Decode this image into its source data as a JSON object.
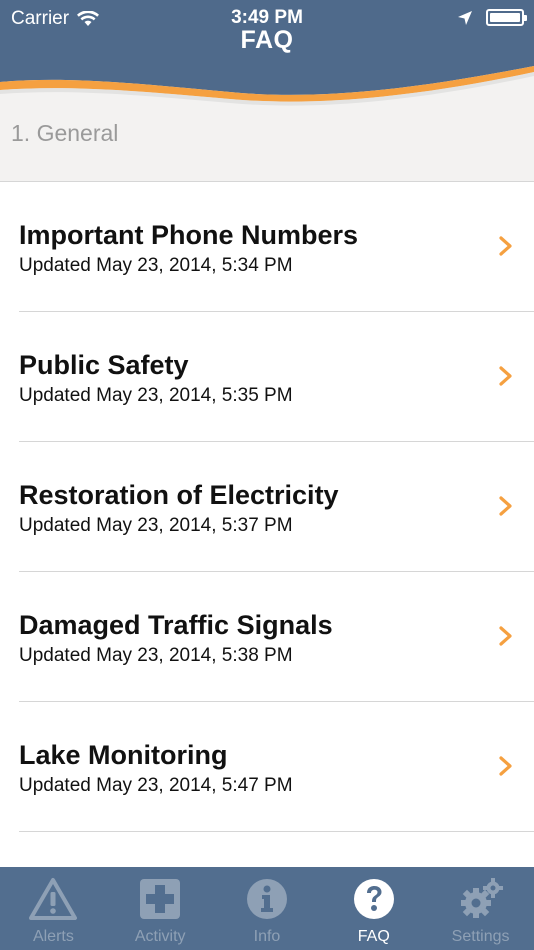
{
  "status_bar": {
    "carrier": "Carrier",
    "time": "3:49 PM",
    "battery_level": 1.0
  },
  "header": {
    "title": "FAQ",
    "section": "1. General"
  },
  "faq_items": [
    {
      "title": "Important Phone Numbers",
      "updated": "Updated May 23, 2014, 5:34 PM"
    },
    {
      "title": "Public Safety",
      "updated": "Updated May 23, 2014, 5:35 PM"
    },
    {
      "title": "Restoration of Electricity",
      "updated": "Updated May 23, 2014, 5:37 PM"
    },
    {
      "title": "Damaged Traffic Signals",
      "updated": "Updated May 23, 2014, 5:38 PM"
    },
    {
      "title": "Lake Monitoring",
      "updated": "Updated May 23, 2014, 5:47 PM"
    }
  ],
  "tab_bar": {
    "tabs": [
      {
        "label": "Alerts",
        "icon": "warning-triangle-icon"
      },
      {
        "label": "Activity",
        "icon": "medical-cross-icon"
      },
      {
        "label": "Info",
        "icon": "info-circle-icon"
      },
      {
        "label": "FAQ",
        "icon": "question-circle-icon"
      },
      {
        "label": "Settings",
        "icon": "gears-icon"
      }
    ],
    "active_tab": "FAQ"
  },
  "colors": {
    "header_blue": "#4f6a8b",
    "accent_orange": "#f5a040",
    "tab_bar_bg": "#526e8f",
    "tab_inactive": "#8ea0b5",
    "tab_active": "#ffffff"
  }
}
